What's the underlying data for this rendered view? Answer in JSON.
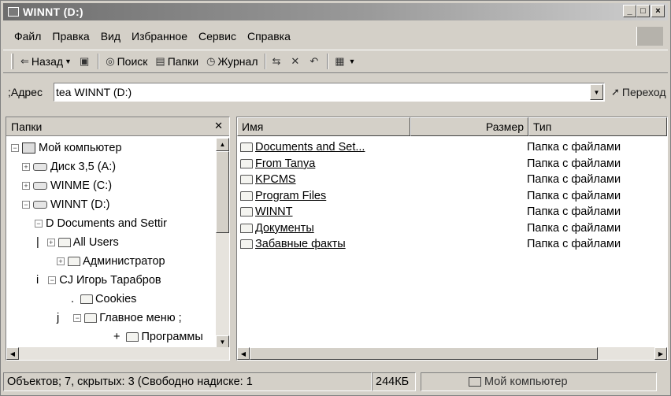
{
  "window": {
    "title": "WINNT (D:)"
  },
  "menu": [
    "Файл",
    "Правка",
    "Вид",
    "Избранное",
    "Сервис",
    "Справка"
  ],
  "toolbar": {
    "back": "Назад",
    "search": "Поиск",
    "folders": "Папки",
    "history": "Журнал"
  },
  "address": {
    "label": ";Адрес",
    "value": "tea WINNT (D:)",
    "go": "Переход"
  },
  "folders_pane": {
    "title": "Папки",
    "tree": [
      {
        "label": "Мой компьютер",
        "prefix": ""
      },
      {
        "label": "Диск 3,5 (A:)",
        "prefix": ""
      },
      {
        "label": "WINME (C:)",
        "prefix": ""
      },
      {
        "label": "WINNT (D:)",
        "prefix": ""
      },
      {
        "label": "D Documents and Settir",
        "prefix": ""
      },
      {
        "label": "All  Users",
        "prefix": "|"
      },
      {
        "label": "Администратор",
        "prefix": ""
      },
      {
        "label": "CJ Игорь Тарабров",
        "prefix": "i"
      },
      {
        "label": "Cookies",
        "prefix": "."
      },
      {
        "label": "Главное меню ;",
        "prefix": "j"
      },
      {
        "label": "Программы",
        "prefix": "+"
      }
    ]
  },
  "files_pane": {
    "columns": {
      "name": "Имя",
      "size": "Размер",
      "type": "Тип"
    },
    "rows": [
      {
        "name": "Documents and Set...",
        "type": "Папка с файлами"
      },
      {
        "name": "From Tanya",
        "type": "Папка с файлами"
      },
      {
        "name": "KPCMS",
        "type": "Папка с файлами"
      },
      {
        "name": "Program Files",
        "type": "Папка с файлами"
      },
      {
        "name": "WINNT",
        "type": "Папка с файлами"
      },
      {
        "name": "Документы",
        "type": "Папка с файлами"
      },
      {
        "name": "Забавные факты",
        "type": "Папка с файлами"
      }
    ]
  },
  "status": {
    "text": "Объектов; 7, скрытых: 3 (Свободно надиске: 1",
    "size": "244КБ",
    "zone": "Мой компьютер"
  }
}
